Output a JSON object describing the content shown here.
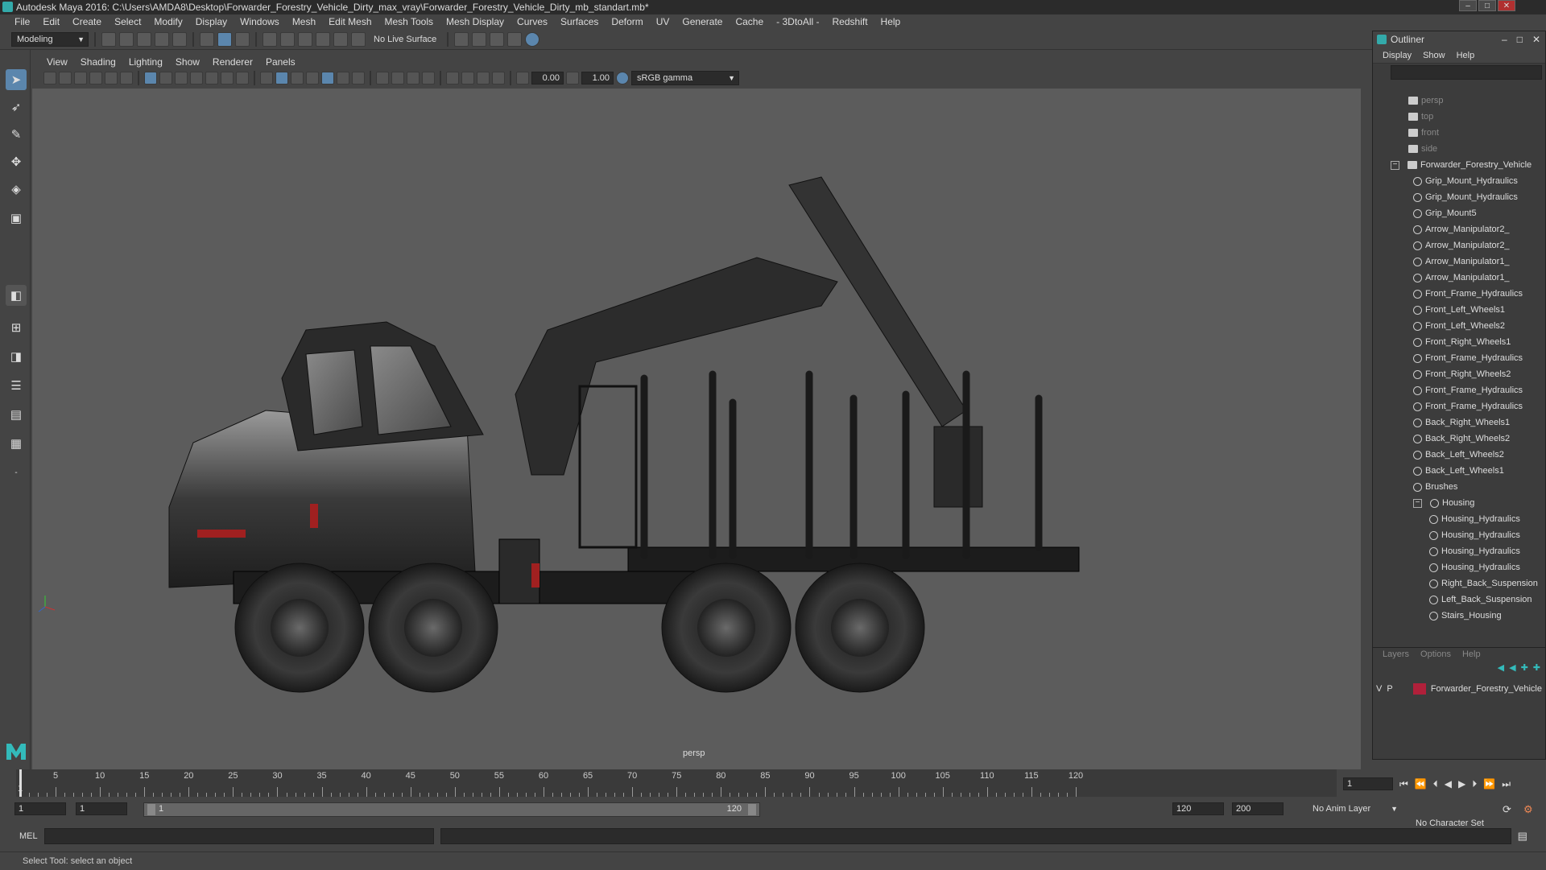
{
  "window": {
    "title": "Autodesk Maya 2016: C:\\Users\\AMDA8\\Desktop\\Forwarder_Forestry_Vehicle_Dirty_max_vray\\Forwarder_Forestry_Vehicle_Dirty_mb_standart.mb*"
  },
  "menubar": [
    "File",
    "Edit",
    "Create",
    "Select",
    "Modify",
    "Display",
    "Windows",
    "Mesh",
    "Edit Mesh",
    "Mesh Tools",
    "Mesh Display",
    "Curves",
    "Surfaces",
    "Deform",
    "UV",
    "Generate",
    "Cache",
    "- 3DtoAll -",
    "Redshift",
    "Help"
  ],
  "statusline": {
    "mode": "Modeling",
    "live_surface": "No Live Surface"
  },
  "viewport": {
    "menu": [
      "View",
      "Shading",
      "Lighting",
      "Show",
      "Renderer",
      "Panels"
    ],
    "exposure": "0.00",
    "gamma": "1.00",
    "color_space": "sRGB gamma",
    "camera_label": "persp"
  },
  "outliner": {
    "title": "Outliner",
    "menu": [
      "Display",
      "Show",
      "Help"
    ],
    "items": [
      {
        "label": "persp",
        "type": "camera",
        "depth": 0,
        "dim": true
      },
      {
        "label": "top",
        "type": "camera",
        "depth": 0,
        "dim": true
      },
      {
        "label": "front",
        "type": "camera",
        "depth": 0,
        "dim": true
      },
      {
        "label": "side",
        "type": "camera",
        "depth": 0,
        "dim": true
      },
      {
        "label": "Forwarder_Forestry_Vehicle",
        "type": "group",
        "depth": 0,
        "expand": "−"
      },
      {
        "label": "Grip_Mount_Hydraulics",
        "type": "mesh",
        "depth": 1
      },
      {
        "label": "Grip_Mount_Hydraulics",
        "type": "mesh",
        "depth": 1
      },
      {
        "label": "Grip_Mount5",
        "type": "mesh",
        "depth": 1
      },
      {
        "label": "Arrow_Manipulator2_",
        "type": "mesh",
        "depth": 1
      },
      {
        "label": "Arrow_Manipulator2_",
        "type": "mesh",
        "depth": 1
      },
      {
        "label": "Arrow_Manipulator1_",
        "type": "mesh",
        "depth": 1
      },
      {
        "label": "Arrow_Manipulator1_",
        "type": "mesh",
        "depth": 1
      },
      {
        "label": "Front_Frame_Hydraulics",
        "type": "mesh",
        "depth": 1
      },
      {
        "label": "Front_Left_Wheels1",
        "type": "mesh",
        "depth": 1
      },
      {
        "label": "Front_Left_Wheels2",
        "type": "mesh",
        "depth": 1
      },
      {
        "label": "Front_Right_Wheels1",
        "type": "mesh",
        "depth": 1
      },
      {
        "label": "Front_Frame_Hydraulics",
        "type": "mesh",
        "depth": 1
      },
      {
        "label": "Front_Right_Wheels2",
        "type": "mesh",
        "depth": 1
      },
      {
        "label": "Front_Frame_Hydraulics",
        "type": "mesh",
        "depth": 1
      },
      {
        "label": "Front_Frame_Hydraulics",
        "type": "mesh",
        "depth": 1
      },
      {
        "label": "Back_Right_Wheels1",
        "type": "mesh",
        "depth": 1
      },
      {
        "label": "Back_Right_Wheels2",
        "type": "mesh",
        "depth": 1
      },
      {
        "label": "Back_Left_Wheels2",
        "type": "mesh",
        "depth": 1
      },
      {
        "label": "Back_Left_Wheels1",
        "type": "mesh",
        "depth": 1
      },
      {
        "label": "Brushes",
        "type": "mesh",
        "depth": 1
      },
      {
        "label": "Housing",
        "type": "mesh",
        "depth": 1,
        "expand": "−"
      },
      {
        "label": "Housing_Hydraulics",
        "type": "mesh",
        "depth": 2
      },
      {
        "label": "Housing_Hydraulics",
        "type": "mesh",
        "depth": 2
      },
      {
        "label": "Housing_Hydraulics",
        "type": "mesh",
        "depth": 2
      },
      {
        "label": "Housing_Hydraulics",
        "type": "mesh",
        "depth": 2
      },
      {
        "label": "Right_Back_Suspension",
        "type": "mesh",
        "depth": 2
      },
      {
        "label": "Left_Back_Suspension",
        "type": "mesh",
        "depth": 2
      },
      {
        "label": "Stairs_Housing",
        "type": "mesh",
        "depth": 2
      }
    ]
  },
  "layers": {
    "menu": [
      "Layers",
      "Options",
      "Help"
    ],
    "row": {
      "v": "V",
      "p": "P",
      "name": "Forwarder_Forestry_Vehicle",
      "color": "#b0203a"
    }
  },
  "timeline": {
    "ticks": [
      "5",
      "10",
      "15",
      "20",
      "25",
      "30",
      "35",
      "40",
      "45",
      "50",
      "55",
      "60",
      "65",
      "70",
      "75",
      "80",
      "85",
      "90",
      "95",
      "100",
      "105",
      "110",
      "115",
      "120"
    ],
    "start_tick": "1",
    "current_frame": "1"
  },
  "range": {
    "start": "1",
    "start2": "1",
    "slider_start": "1",
    "slider_end": "120",
    "end": "120",
    "end2": "200",
    "anim_layer": "No Anim Layer",
    "character_set": "No Character Set"
  },
  "cmdline": {
    "label": "MEL"
  },
  "helpline": {
    "text": "Select Tool: select an object"
  }
}
